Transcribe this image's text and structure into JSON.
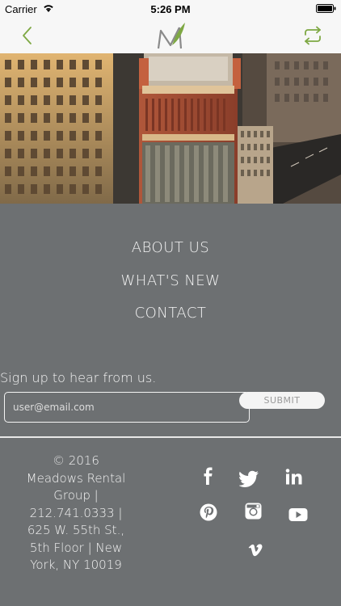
{
  "status_bar": {
    "carrier": "Carrier",
    "time": "5:26 PM"
  },
  "nav": {
    "back_icon": "chevron-left-icon",
    "logo": "meadows-logo",
    "refresh_icon": "repeat-icon",
    "accent_color": "#7ea843"
  },
  "hero": {
    "subject": "aerial city buildings at sunset"
  },
  "menu": {
    "items": [
      {
        "label": "ABOUT US"
      },
      {
        "label": "WHAT'S NEW"
      },
      {
        "label": "CONTACT"
      }
    ]
  },
  "signup": {
    "heading": "Sign up to hear from us.",
    "email_placeholder": "user@email.com",
    "submit_label": "SUBMIT"
  },
  "footer": {
    "lines": [
      "© 2016",
      "Meadows Rental",
      "Group |",
      "212.741.0333 |",
      "625 W. 55th St.,",
      "5th Floor | New",
      "York, NY 10019"
    ],
    "social": [
      "facebook-icon",
      "twitter-icon",
      "linkedin-icon",
      "pinterest-icon",
      "instagram-icon",
      "youtube-icon",
      "vimeo-icon"
    ]
  },
  "colors": {
    "background": "#6d7072",
    "text": "#f4f4f4",
    "bar": "#f7f7f7"
  }
}
